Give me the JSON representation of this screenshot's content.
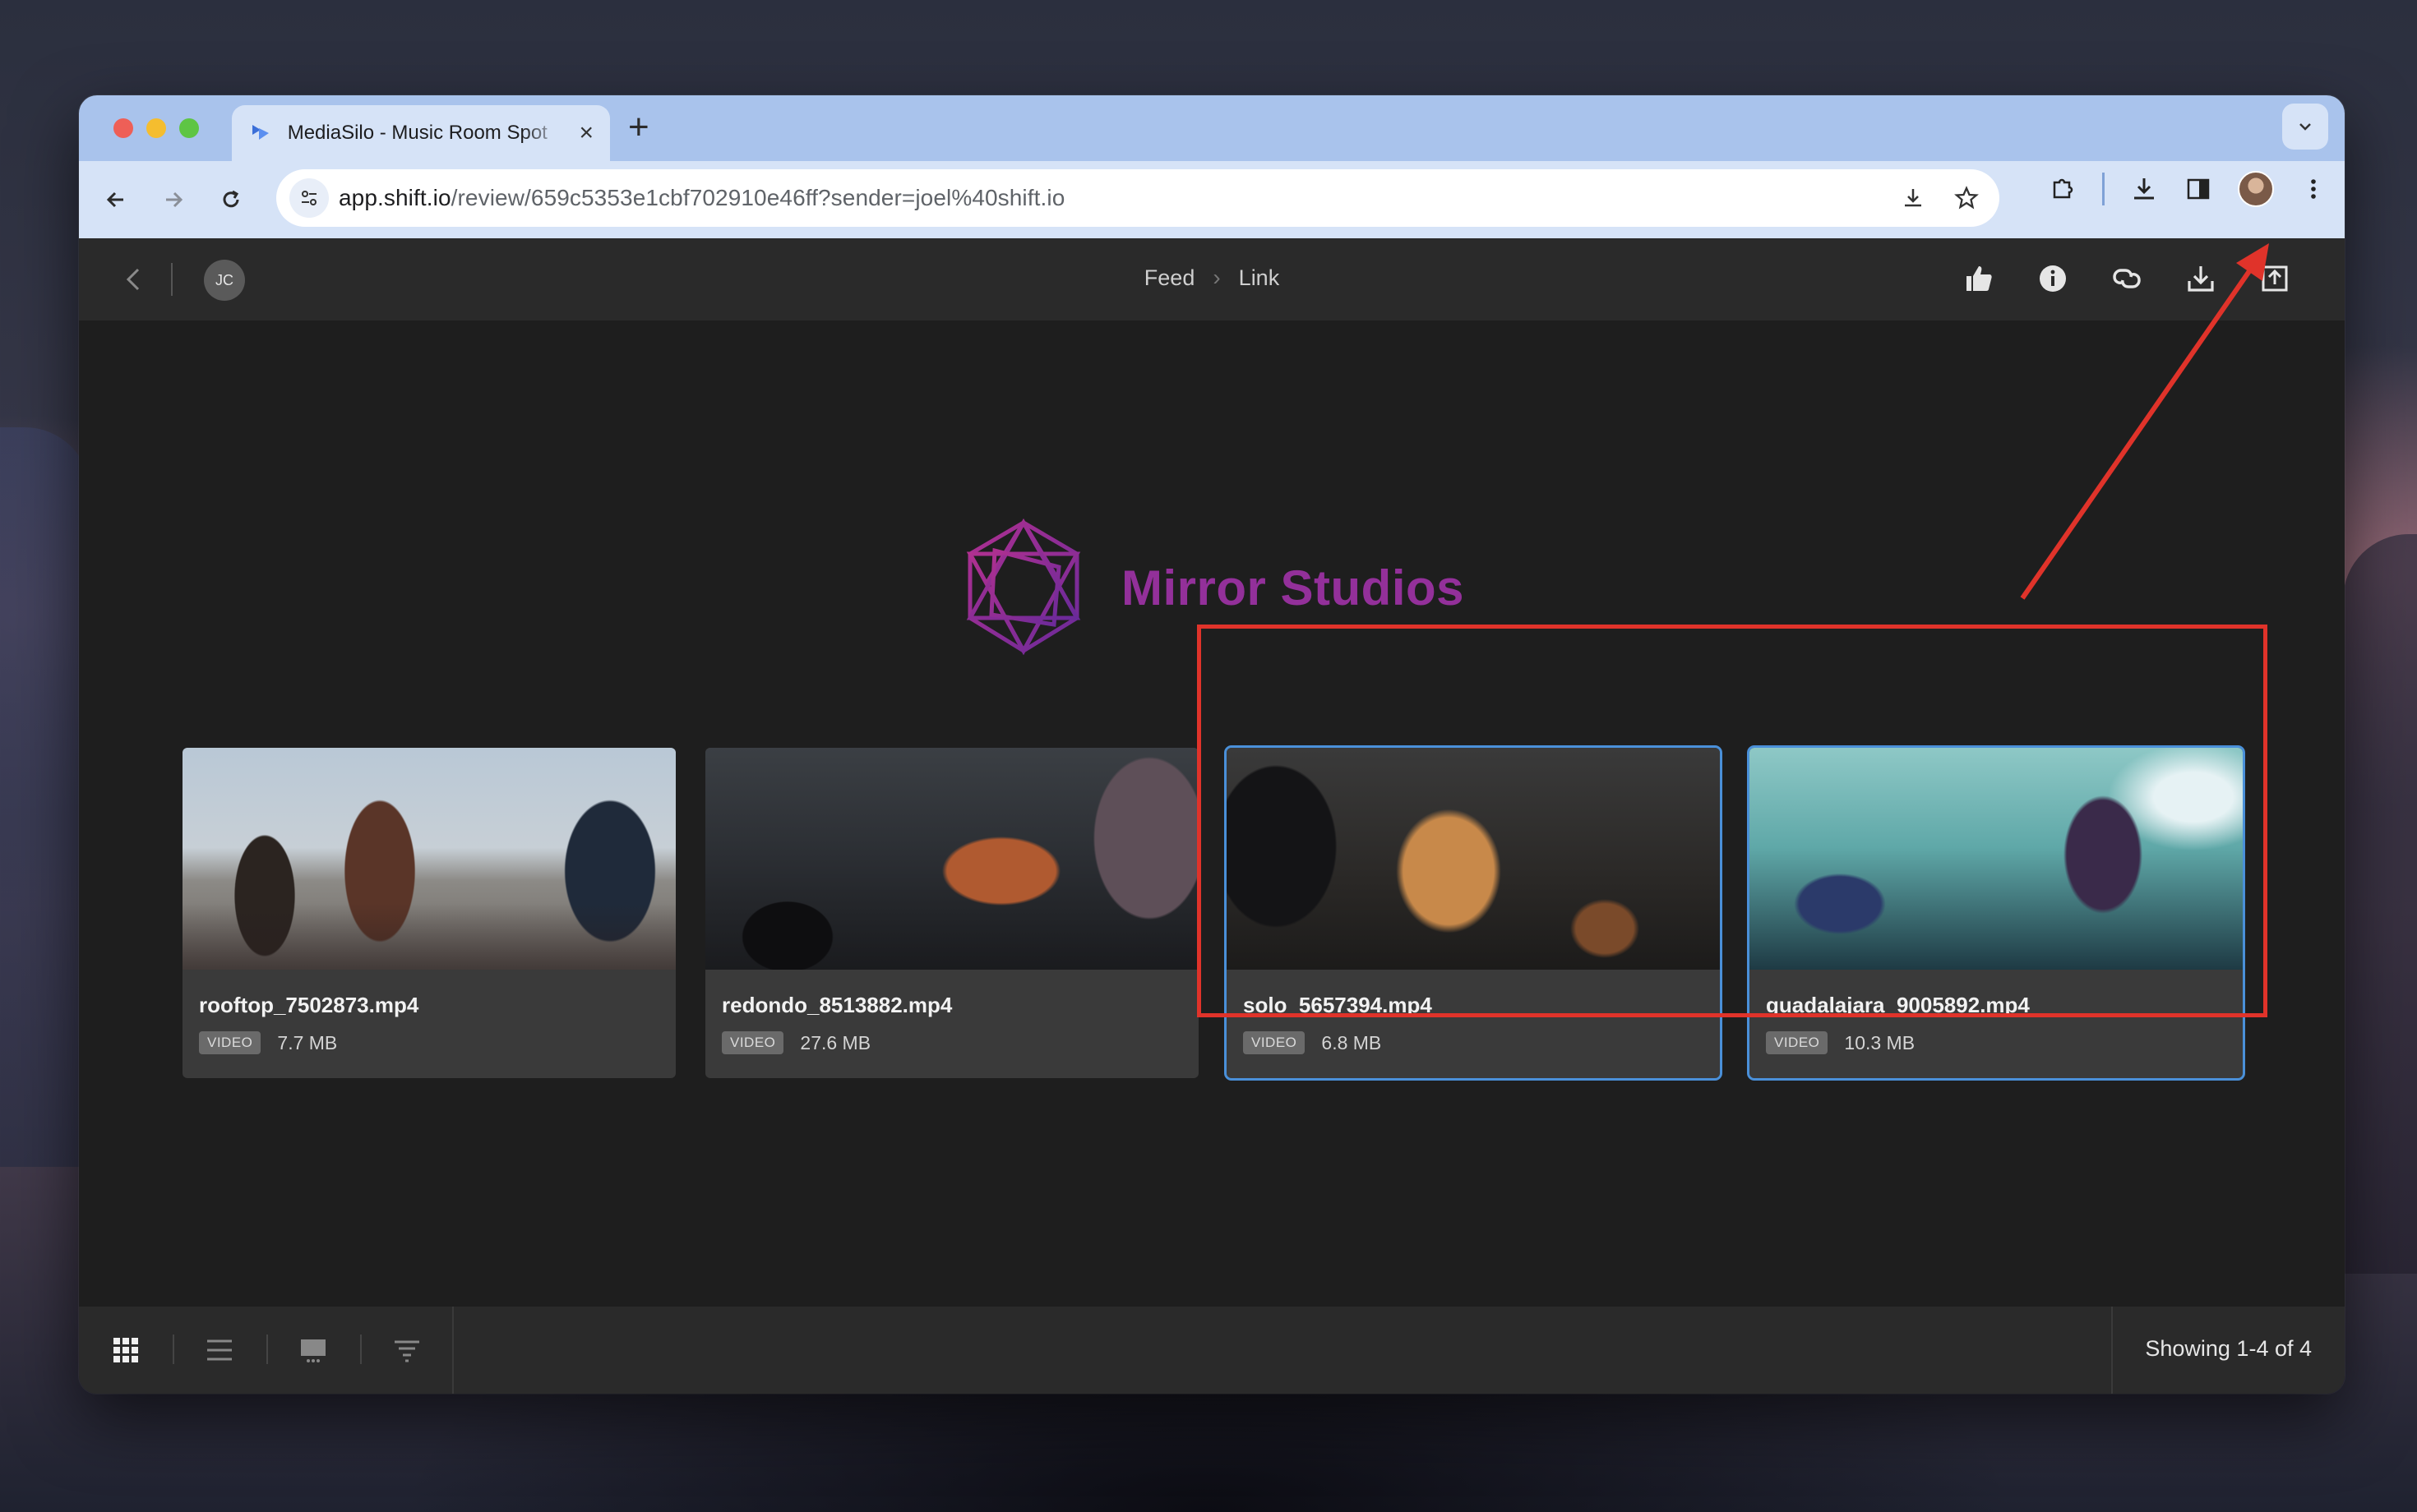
{
  "browser": {
    "tab_title": "MediaSilo - Music Room Spot",
    "url_domain": "app.shift.io",
    "url_path": "/review/659c5353e1cbf702910e46ff?sender=joel%40shift.io"
  },
  "header": {
    "user_initials": "JC",
    "breadcrumb": [
      "Feed",
      "Link"
    ]
  },
  "brand": {
    "name": "Mirror Studios",
    "color": "#93309a"
  },
  "assets": [
    {
      "name": "rooftop_7502873.mp4",
      "type": "VIDEO",
      "size": "7.7 MB",
      "selected": false
    },
    {
      "name": "redondo_8513882.mp4",
      "type": "VIDEO",
      "size": "27.6 MB",
      "selected": false
    },
    {
      "name": "solo_5657394.mp4",
      "type": "VIDEO",
      "size": "6.8 MB",
      "selected": true
    },
    {
      "name": "guadalajara_9005892.mp4",
      "type": "VIDEO",
      "size": "10.3 MB",
      "selected": true
    }
  ],
  "footer": {
    "showing": "Showing 1-4 of 4"
  },
  "icons": {
    "header": [
      "thumbs-up-icon",
      "info-icon",
      "link-icon",
      "download-icon",
      "share-icon"
    ],
    "footer": [
      "grid-view-icon",
      "list-view-icon",
      "presentation-view-icon",
      "filter-icon"
    ]
  },
  "annotation": {
    "color": "#e0332a"
  }
}
